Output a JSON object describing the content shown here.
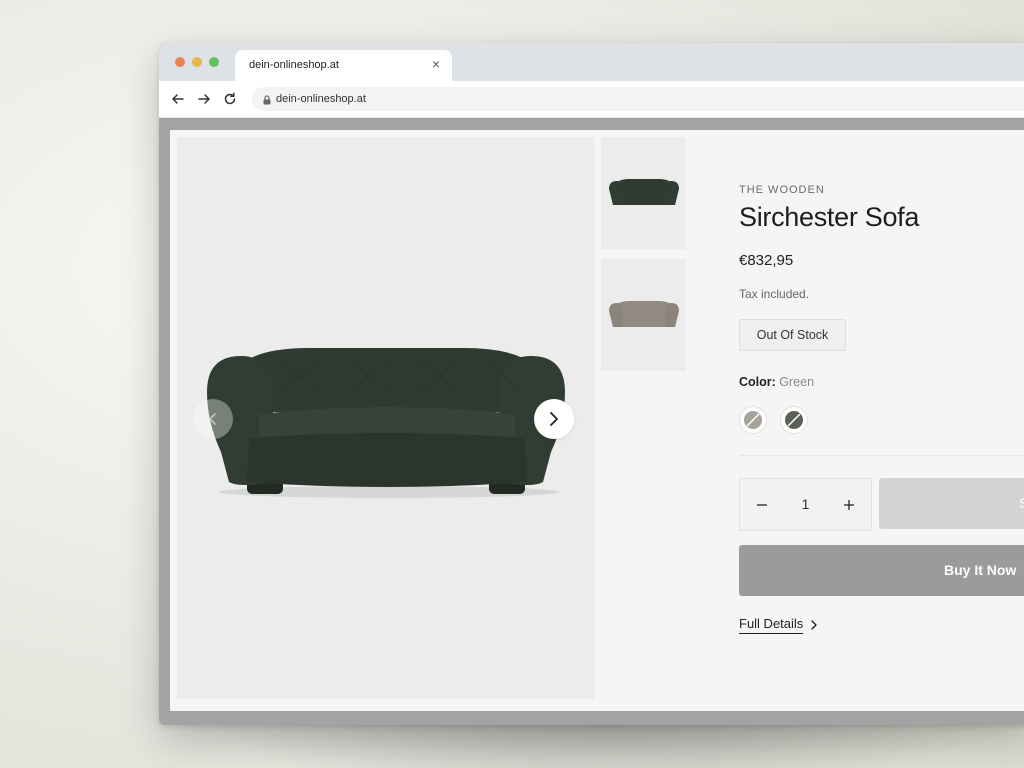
{
  "browser": {
    "tab_title": "dein-onlineshop.at",
    "url": "dein-onlineshop.at"
  },
  "product": {
    "vendor": "THE WOODEN",
    "title": "Sirchester Sofa",
    "price": "€832,95",
    "tax_note": "Tax included.",
    "stock_status": "Out Of Stock",
    "color_label": "Color:",
    "color_value": "Green",
    "quantity": "1",
    "add_to_cart_label": "S",
    "buy_now_label": "Buy It Now",
    "full_details_label": "Full Details"
  },
  "colors": {
    "sofa_green": "#2f3a31",
    "sofa_grey": "#918b82",
    "buy_now_bg": "#9b9b9b"
  }
}
